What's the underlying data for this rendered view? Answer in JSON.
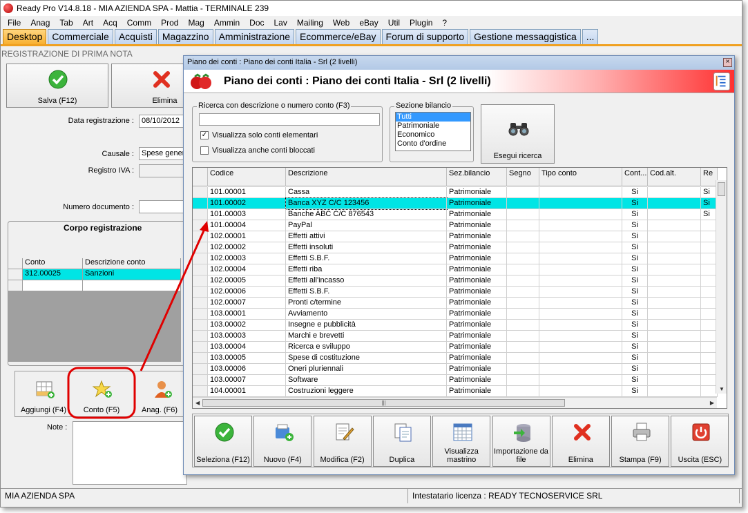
{
  "window": {
    "title": "Ready Pro V14.8.18 - MIA AZIENDA SPA - Mattia - TERMINALE 239"
  },
  "menu": [
    "File",
    "Anag",
    "Tab",
    "Art",
    "Acq",
    "Comm",
    "Prod",
    "Mag",
    "Ammin",
    "Doc",
    "Lav",
    "Mailing",
    "Web",
    "eBay",
    "Util",
    "Plugin",
    "?"
  ],
  "tabs": [
    "Desktop",
    "Commerciale",
    "Acquisti",
    "Magazzino",
    "Amministrazione",
    "Ecommerce/eBay",
    "Forum di supporto",
    "Gestione messaggistica",
    "..."
  ],
  "form": {
    "title": "REGISTRAZIONE DI PRIMA NOTA",
    "save_label": "Salva (F12)",
    "delete_label": "Elimina",
    "data_label": "Data registrazione :",
    "data_value": "08/10/2012",
    "causale_label": "Causale :",
    "causale_value": "Spese gener",
    "registro_label": "Registro IVA :",
    "numero_label": "Numero documento :",
    "corpo_label": "Corpo registrazione",
    "grid_headers": [
      "Conto",
      "Descrizione conto"
    ],
    "grid_row": {
      "conto": "312.00025",
      "descrizione": "Sanzioni"
    },
    "btn_aggiungi": "Aggiungi (F4)",
    "btn_conto": "Conto (F5)",
    "btn_anag": "Anag. (F6)",
    "note_label": "Note :"
  },
  "status": {
    "company": "MIA AZIENDA SPA",
    "license": "Intestatario licenza : READY TECNOSERVICE SRL"
  },
  "dialog": {
    "window_title": "Piano dei conti : Piano dei conti Italia - Srl (2 livelli)",
    "header_title": "Piano dei conti : Piano dei conti Italia - Srl (2 livelli)",
    "search_caption": "Ricerca con descrizione o numero conto (F3)",
    "search_value": "",
    "chk_elementari": "Visualizza solo conti elementari",
    "chk_elementari_checked": true,
    "chk_bloccati": "Visualizza anche conti bloccati",
    "chk_bloccati_checked": false,
    "sezione_caption": "Sezione bilancio",
    "sezione_options": [
      "Tutti",
      "Patrimoniale",
      "Economico",
      "Conto d'ordine"
    ],
    "sezione_selected": "Tutti",
    "esegui_label": "Esegui ricerca",
    "columns": [
      "Codice",
      "Descrizione",
      "Sez.bilancio",
      "Segno",
      "Tipo conto",
      "Cont...",
      "Cod.alt.",
      "Re"
    ],
    "rows": [
      {
        "codice": "101.00001",
        "descrizione": "Cassa",
        "sez": "Patrimoniale",
        "cont": "Si",
        "re": "Si"
      },
      {
        "codice": "101.00002",
        "descrizione": "Banca XYZ C/C 123456",
        "sez": "Patrimoniale",
        "cont": "Si",
        "re": "Si"
      },
      {
        "codice": "101.00003",
        "descrizione": "Banche ABC C/C 876543",
        "sez": "Patrimoniale",
        "cont": "Si",
        "re": "Si"
      },
      {
        "codice": "101.00004",
        "descrizione": "PayPal",
        "sez": "Patrimoniale",
        "cont": "Si",
        "re": ""
      },
      {
        "codice": "102.00001",
        "descrizione": "Effetti attivi",
        "sez": "Patrimoniale",
        "cont": "Si",
        "re": ""
      },
      {
        "codice": "102.00002",
        "descrizione": "Effetti insoluti",
        "sez": "Patrimoniale",
        "cont": "Si",
        "re": ""
      },
      {
        "codice": "102.00003",
        "descrizione": "Effetti S.B.F.",
        "sez": "Patrimoniale",
        "cont": "Si",
        "re": ""
      },
      {
        "codice": "102.00004",
        "descrizione": "Effetti riba",
        "sez": "Patrimoniale",
        "cont": "Si",
        "re": ""
      },
      {
        "codice": "102.00005",
        "descrizione": "Effetti all'incasso",
        "sez": "Patrimoniale",
        "cont": "Si",
        "re": ""
      },
      {
        "codice": "102.00006",
        "descrizione": "Effetti S.B.F.",
        "sez": "Patrimoniale",
        "cont": "Si",
        "re": ""
      },
      {
        "codice": "102.00007",
        "descrizione": "Pronti c/termine",
        "sez": "Patrimoniale",
        "cont": "Si",
        "re": ""
      },
      {
        "codice": "103.00001",
        "descrizione": "Avviamento",
        "sez": "Patrimoniale",
        "cont": "Si",
        "re": ""
      },
      {
        "codice": "103.00002",
        "descrizione": "Insegne e pubblicità",
        "sez": "Patrimoniale",
        "cont": "Si",
        "re": ""
      },
      {
        "codice": "103.00003",
        "descrizione": "Marchi e brevetti",
        "sez": "Patrimoniale",
        "cont": "Si",
        "re": ""
      },
      {
        "codice": "103.00004",
        "descrizione": "Ricerca e sviluppo",
        "sez": "Patrimoniale",
        "cont": "Si",
        "re": ""
      },
      {
        "codice": "103.00005",
        "descrizione": "Spese di costituzione",
        "sez": "Patrimoniale",
        "cont": "Si",
        "re": ""
      },
      {
        "codice": "103.00006",
        "descrizione": "Oneri pluriennali",
        "sez": "Patrimoniale",
        "cont": "Si",
        "re": ""
      },
      {
        "codice": "103.00007",
        "descrizione": "Software",
        "sez": "Patrimoniale",
        "cont": "Si",
        "re": ""
      },
      {
        "codice": "104.00001",
        "descrizione": "Costruzioni leggere",
        "sez": "Patrimoniale",
        "cont": "Si",
        "re": ""
      }
    ],
    "selected_row": 1,
    "buttons": [
      "Seleziona (F12)",
      "Nuovo (F4)",
      "Modifica (F2)",
      "Duplica",
      "Visualizza mastrino",
      "Importazione da file",
      "Elimina",
      "Stampa (F9)",
      "Uscita (ESC)"
    ]
  },
  "colors": {
    "tab_active": "#f8b030",
    "row_selected": "#00e5e5",
    "annotation": "#e00000"
  }
}
